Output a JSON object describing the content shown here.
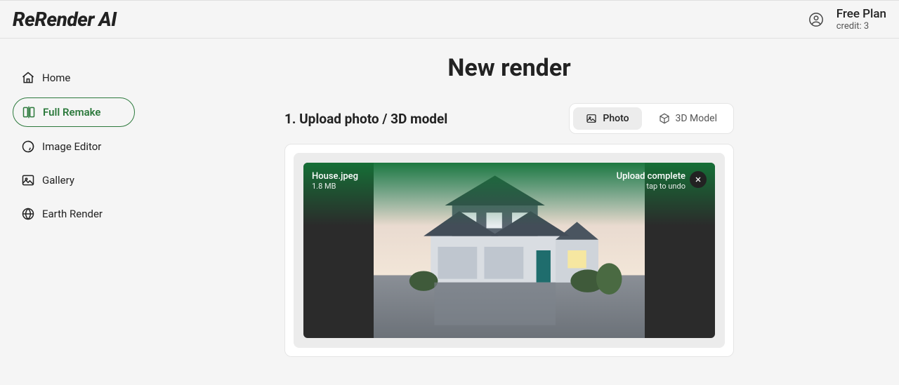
{
  "header": {
    "logo": "ReRender AI",
    "plan_name": "Free Plan",
    "credit_label": "credit: 3"
  },
  "sidebar": {
    "items": [
      {
        "label": "Home"
      },
      {
        "label": "Full Remake"
      },
      {
        "label": "Image Editor"
      },
      {
        "label": "Gallery"
      },
      {
        "label": "Earth Render"
      }
    ]
  },
  "main": {
    "title": "New render",
    "section_title": "1. Upload photo / 3D model",
    "toggle": {
      "photo": "Photo",
      "model_3d": "3D Model"
    },
    "upload": {
      "file_name": "House.jpeg",
      "file_size": "1.8 MB",
      "status": "Upload complete",
      "status_hint": "tap to undo"
    }
  }
}
